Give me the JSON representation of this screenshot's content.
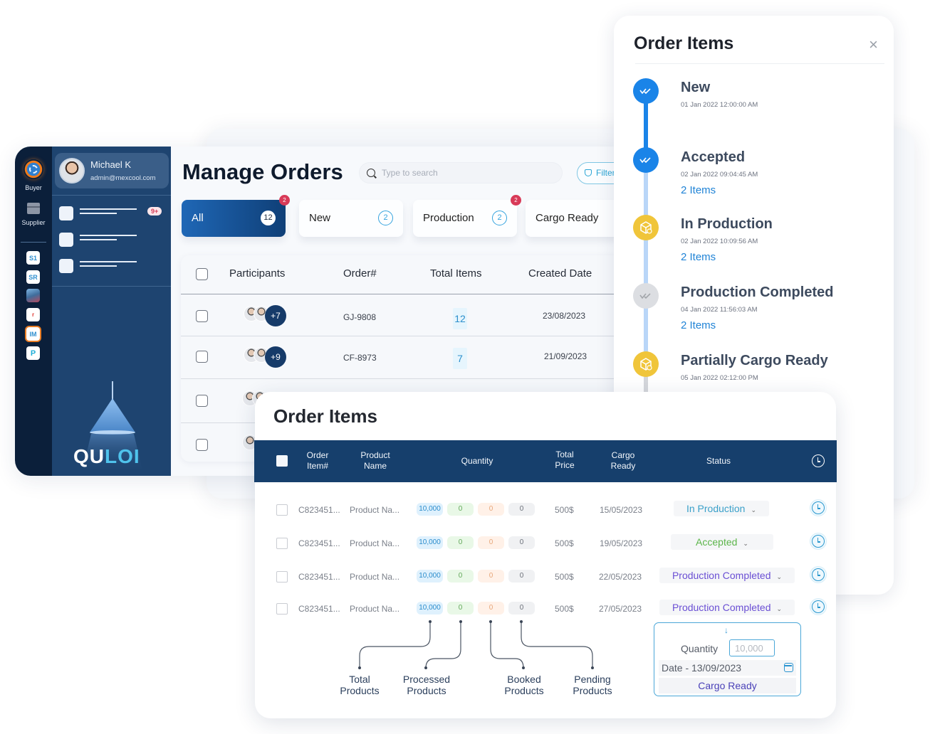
{
  "colors": {
    "brand_navy": "#163f6c",
    "accent_blue": "#1a84e8",
    "status_in_production": "#3aa0c9",
    "status_accepted": "#5cb54a",
    "status_completed": "#6a4fd4",
    "badge_red": "#d83a58"
  },
  "rail": {
    "buyer_label": "Buyer",
    "supplier_label": "Supplier",
    "apps": [
      {
        "icon": "s1-app-icon",
        "label": "S1"
      },
      {
        "icon": "sr-app-icon",
        "label": "SR"
      },
      {
        "icon": "ship-photo-app-icon",
        "label": ""
      },
      {
        "icon": "r-app-icon",
        "label": "r"
      },
      {
        "icon": "im-app-icon",
        "label": "IM"
      },
      {
        "icon": "p-app-icon",
        "label": "P"
      }
    ]
  },
  "user": {
    "name": "Michael K",
    "email": "admin@mexcool.com"
  },
  "sidebar": {
    "notification_badge": "9+"
  },
  "logo": {
    "part1": "QU",
    "part2": "LOI"
  },
  "manage_orders": {
    "title": "Manage Orders",
    "search_placeholder": "Type to search",
    "filter_label": "Filter",
    "tabs": [
      {
        "label": "All",
        "count": "12",
        "alert": "2",
        "active": true
      },
      {
        "label": "New",
        "count": "2",
        "alert": null,
        "active": false
      },
      {
        "label": "Production",
        "count": "2",
        "alert": "2",
        "active": false
      },
      {
        "label": "Cargo Ready",
        "count": "",
        "alert": null,
        "active": false
      }
    ],
    "columns": [
      "Participants",
      "Order#",
      "Total Items",
      "Created Date"
    ],
    "rows": [
      {
        "more": "+7",
        "order": "GJ-9808",
        "items": "12",
        "date": "23/08/2023"
      },
      {
        "more": "+9",
        "order": "CF-8973",
        "items": "7",
        "date": "21/09/2023"
      },
      {
        "more": "",
        "order": "",
        "items": "",
        "date": ""
      },
      {
        "more": "",
        "order": "",
        "items": "",
        "date": ""
      }
    ]
  },
  "timeline": {
    "title": "Order Items",
    "close": "×",
    "steps": [
      {
        "name": "New",
        "date": "01 Jan 2022 12:00:00 AM",
        "items": "",
        "state": "blue"
      },
      {
        "name": "Accepted",
        "date": "02 Jan 2022 09:04:45 AM",
        "items": "2 Items",
        "state": "blue"
      },
      {
        "name": "In Production",
        "date": "02 Jan 2022 10:09:56 AM",
        "items": "2 Items",
        "state": "yellow"
      },
      {
        "name": "Production Completed",
        "date": "04 Jan 2022 11:56:03 AM",
        "items": "2 Items",
        "state": "gray"
      },
      {
        "name": "Partially Cargo Ready",
        "date": "05 Jan 2022 02:12:00 PM",
        "items": "",
        "state": "yellow"
      }
    ]
  },
  "order_items": {
    "title": "Order Items",
    "columns": {
      "item": "Order Item#",
      "product": "Product Name",
      "quantity": "Quantity",
      "price": "Total Price",
      "cargo": "Cargo Ready",
      "status": "Status"
    },
    "rows": [
      {
        "item": "C823451...",
        "product": "Product Na...",
        "total": "10,000",
        "processed": "0",
        "booked": "0",
        "pending": "0",
        "price": "500$",
        "cargo": "15/05/2023",
        "status": "In Production"
      },
      {
        "item": "C823451...",
        "product": "Product Na...",
        "total": "10,000",
        "processed": "0",
        "booked": "0",
        "pending": "0",
        "price": "500$",
        "cargo": "19/05/2023",
        "status": "Accepted"
      },
      {
        "item": "C823451...",
        "product": "Product Na...",
        "total": "10,000",
        "processed": "0",
        "booked": "0",
        "pending": "0",
        "price": "500$",
        "cargo": "22/05/2023",
        "status": "Production Completed"
      },
      {
        "item": "C823451...",
        "product": "Product Na...",
        "total": "10,000",
        "processed": "0",
        "booked": "0",
        "pending": "0",
        "price": "500$",
        "cargo": "27/05/2023",
        "status": "Production Completed"
      }
    ],
    "callouts": {
      "total": "Total Products",
      "processed": "Processed Products",
      "booked": "Booked Products",
      "pending": "Pending Products"
    },
    "popup": {
      "quantity_label": "Quantity",
      "quantity_placeholder": "10,000",
      "date_label": "Date - 13/09/2023",
      "action": "Cargo Ready"
    }
  }
}
